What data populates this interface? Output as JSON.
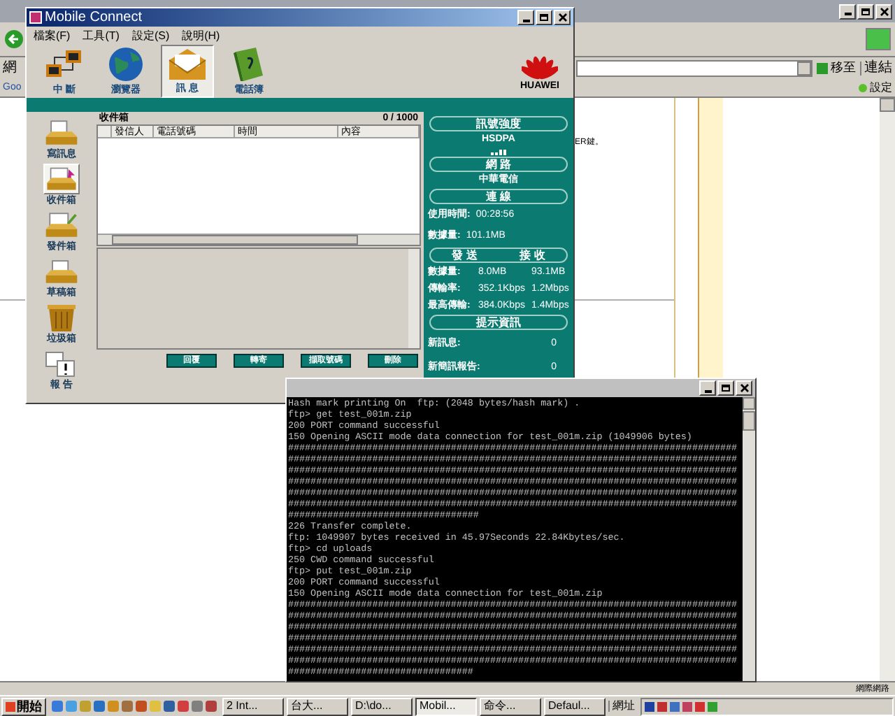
{
  "browser": {
    "address_label": "網",
    "go_button": "移至",
    "links_button": "連結",
    "toolbar_text": "Goo",
    "settings_button": "設定",
    "content_text": "ER鍵。",
    "status_zone": "網際網路"
  },
  "mobile_connect": {
    "title": "Mobile Connect",
    "menu": [
      "檔案(F)",
      "工具(T)",
      "設定(S)",
      "說明(H)"
    ],
    "toolbar": [
      {
        "label": "中 斷",
        "kind": "disconnect",
        "selected": false
      },
      {
        "label": "瀏覽器",
        "kind": "browser",
        "selected": false
      },
      {
        "label": "訊 息",
        "kind": "message",
        "selected": true
      },
      {
        "label": "電話簿",
        "kind": "phonebook",
        "selected": false
      }
    ],
    "brand": "HUAWEI",
    "folders": [
      {
        "label": "寫訊息",
        "kind": "compose",
        "selected": false
      },
      {
        "label": "收件箱",
        "kind": "inbox",
        "selected": true
      },
      {
        "label": "發件箱",
        "kind": "outbox",
        "selected": false
      },
      {
        "label": "草稿箱",
        "kind": "drafts",
        "selected": false
      },
      {
        "label": "垃圾箱",
        "kind": "trash",
        "selected": false
      },
      {
        "label": "報 告",
        "kind": "report",
        "selected": false
      }
    ],
    "list": {
      "title": "收件箱",
      "count": "0 / 1000",
      "columns": [
        "發信人",
        "電話號碼",
        "時間",
        "內容"
      ]
    },
    "buttons": [
      "回覆",
      "轉寄",
      "擷取號碼",
      "刪除"
    ],
    "status": [
      {
        "kind": "pill",
        "text": "訊號強度"
      },
      {
        "kind": "center",
        "text": "HSDPA"
      },
      {
        "kind": "signal"
      },
      {
        "kind": "pill",
        "text": "網 路"
      },
      {
        "kind": "center",
        "text": "中華電信"
      },
      {
        "kind": "pill",
        "text": "連 線"
      },
      {
        "kind": "field",
        "label": "使用時間:",
        "value": "00:28:56"
      },
      {
        "kind": "field",
        "label": "數據量:",
        "value": "101.1MB"
      },
      {
        "kind": "pill_pair",
        "left": "發 送",
        "right": "接 收"
      },
      {
        "kind": "field2",
        "label": "數據量:",
        "send": "8.0MB",
        "receive": "93.1MB"
      },
      {
        "kind": "field2",
        "label": "傳輸率:",
        "send": "352.1Kbps",
        "receive": "1.2Mbps"
      },
      {
        "kind": "field2",
        "label": "最高傳輸:",
        "send": "384.0Kbps",
        "receive": "1.4Mbps"
      },
      {
        "kind": "pill",
        "text": "提示資訊"
      },
      {
        "kind": "count",
        "label": "新訊息:",
        "value": "0"
      },
      {
        "kind": "count",
        "label": "新簡訊報告:",
        "value": "0"
      }
    ]
  },
  "console": {
    "lines": [
      "Hash mark printing On  ftp: (2048 bytes/hash mark) .",
      "ftp> get test_001m.zip",
      "200 PORT command successful",
      "150 Opening ASCII mode data connection for test_001m.zip (1049906 bytes)",
      "################################################################################",
      "################################################################################",
      "################################################################################",
      "################################################################################",
      "################################################################################",
      "################################################################################",
      "##################################",
      "226 Transfer complete.",
      "ftp: 1049907 bytes received in 45.97Seconds 22.84Kbytes/sec.",
      "ftp> cd uploads",
      "250 CWD command successful",
      "ftp> put test_001m.zip",
      "200 PORT command successful",
      "150 Opening ASCII mode data connection for test_001m.zip",
      "################################################################################",
      "################################################################################",
      "################################################################################",
      "################################################################################",
      "################################################################################",
      "################################################################################",
      "#################################"
    ]
  },
  "taskbar": {
    "start": "開始",
    "tasks": [
      {
        "label": "2 Int...",
        "selected": false
      },
      {
        "label": "台大...",
        "selected": false
      },
      {
        "label": "D:\\do...",
        "selected": false
      },
      {
        "label": "Mobil...",
        "selected": true
      },
      {
        "label": "命令...",
        "selected": false
      },
      {
        "label": "Defaul...",
        "selected": false
      }
    ],
    "address_label": "網址"
  }
}
